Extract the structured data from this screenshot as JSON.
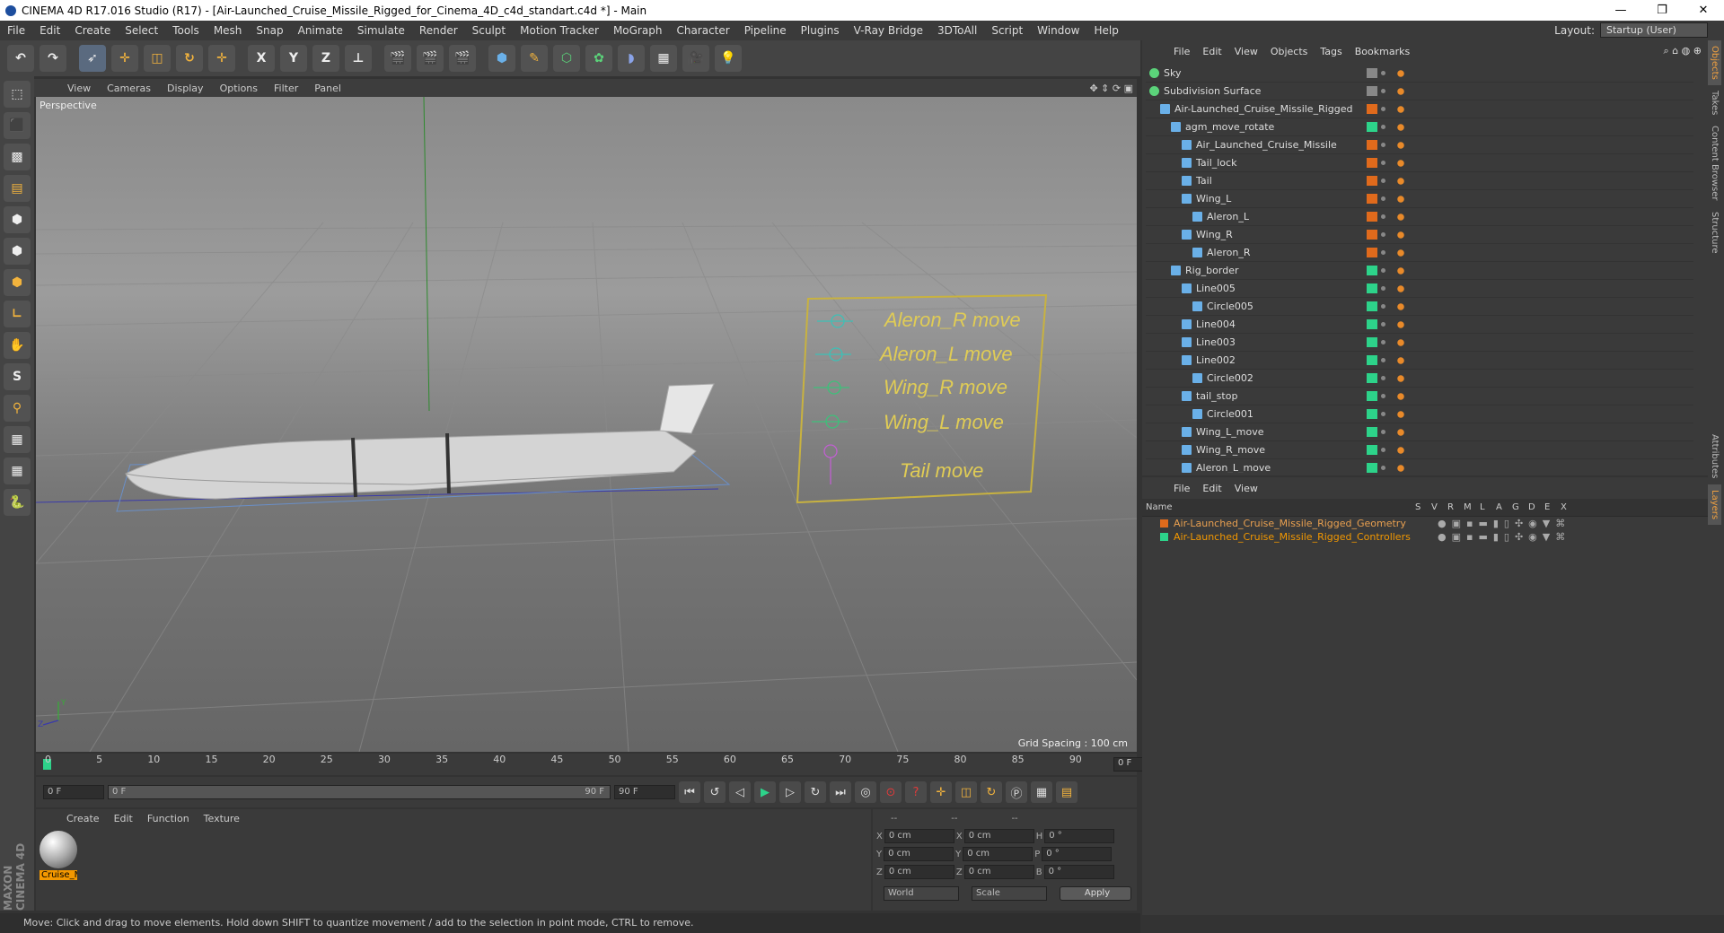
{
  "window": {
    "title": "CINEMA 4D R17.016 Studio (R17) - [Air-Launched_Cruise_Missile_Rigged_for_Cinema_4D_c4d_standart.c4d *] - Main",
    "controls": [
      "—",
      "❐",
      "✕"
    ]
  },
  "menu": [
    "File",
    "Edit",
    "Create",
    "Select",
    "Tools",
    "Mesh",
    "Snap",
    "Animate",
    "Simulate",
    "Render",
    "Sculpt",
    "Motion Tracker",
    "MoGraph",
    "Character",
    "Pipeline",
    "Plugins",
    "V-Ray Bridge",
    "3DToAll",
    "Script",
    "Window",
    "Help"
  ],
  "layout": {
    "label": "Layout:",
    "value": "Startup (User)"
  },
  "toolbar": {
    "x": "X",
    "y": "Y",
    "z": "Z"
  },
  "viewport": {
    "menu": [
      "View",
      "Cameras",
      "Display",
      "Options",
      "Filter",
      "Panel"
    ],
    "label": "Perspective",
    "grid_spacing": "Grid Spacing : 100 cm",
    "controls": [
      "Aleron_R move",
      "Aleron_L move",
      "Wing_R move",
      "Wing_L move",
      "Tail move"
    ],
    "axis_y": "Y",
    "axis_z": "Z"
  },
  "timeline": {
    "ticks": [
      "0",
      "5",
      "10",
      "15",
      "20",
      "25",
      "30",
      "35",
      "40",
      "45",
      "50",
      "55",
      "60",
      "65",
      "70",
      "75",
      "80",
      "85",
      "90"
    ],
    "current": "0 F"
  },
  "playback": {
    "start": "0 F",
    "range_start": "0 F",
    "range_end": "90 F",
    "end": "90 F"
  },
  "material": {
    "menu": [
      "Create",
      "Edit",
      "Function",
      "Texture"
    ],
    "name": "Cruise_M"
  },
  "coords": {
    "header": [
      "--",
      "--",
      "--"
    ],
    "rows": [
      {
        "a": "X",
        "v1": "0 cm",
        "b": "X",
        "v2": "0 cm",
        "c": "H",
        "v3": "0 °"
      },
      {
        "a": "Y",
        "v1": "0 cm",
        "b": "Y",
        "v2": "0 cm",
        "c": "P",
        "v3": "0 °"
      },
      {
        "a": "Z",
        "v1": "0 cm",
        "b": "Z",
        "v2": "0 cm",
        "c": "B",
        "v3": "0 °"
      }
    ],
    "world": "World",
    "scale": "Scale",
    "apply": "Apply"
  },
  "status": "Move: Click and drag to move elements. Hold down SHIFT to quantize movement / add to the selection in point mode, CTRL to remove.",
  "brand": "MAXON CINEMA 4D",
  "objects": {
    "menu": [
      "File",
      "Edit",
      "View",
      "Objects",
      "Tags",
      "Bookmarks"
    ],
    "rows": [
      {
        "name": "Sky",
        "indent": 0,
        "color": "#888888"
      },
      {
        "name": "Subdivision Surface",
        "indent": 0,
        "color": "#888888"
      },
      {
        "name": "Air-Launched_Cruise_Missile_Rigged",
        "indent": 1,
        "color": "#e06a1c"
      },
      {
        "name": "agm_move_rotate",
        "indent": 2,
        "color": "#2dd38a"
      },
      {
        "name": "Air_Launched_Cruise_Missile",
        "indent": 3,
        "color": "#e06a1c"
      },
      {
        "name": "Tail_lock",
        "indent": 3,
        "color": "#e06a1c"
      },
      {
        "name": "Tail",
        "indent": 3,
        "color": "#e06a1c"
      },
      {
        "name": "Wing_L",
        "indent": 3,
        "color": "#e06a1c"
      },
      {
        "name": "Aleron_L",
        "indent": 4,
        "color": "#e06a1c"
      },
      {
        "name": "Wing_R",
        "indent": 3,
        "color": "#e06a1c"
      },
      {
        "name": "Aleron_R",
        "indent": 4,
        "color": "#e06a1c"
      },
      {
        "name": "Rig_border",
        "indent": 2,
        "color": "#2dd38a"
      },
      {
        "name": "Line005",
        "indent": 3,
        "color": "#2dd38a"
      },
      {
        "name": "Circle005",
        "indent": 4,
        "color": "#2dd38a"
      },
      {
        "name": "Line004",
        "indent": 3,
        "color": "#2dd38a"
      },
      {
        "name": "Line003",
        "indent": 3,
        "color": "#2dd38a"
      },
      {
        "name": "Line002",
        "indent": 3,
        "color": "#2dd38a"
      },
      {
        "name": "Circle002",
        "indent": 4,
        "color": "#2dd38a"
      },
      {
        "name": "tail_stop",
        "indent": 3,
        "color": "#2dd38a"
      },
      {
        "name": "Circle001",
        "indent": 4,
        "color": "#2dd38a"
      },
      {
        "name": "Wing_L_move",
        "indent": 3,
        "color": "#2dd38a"
      },
      {
        "name": "Wing_R_move",
        "indent": 3,
        "color": "#2dd38a"
      },
      {
        "name": "Aleron_L_move",
        "indent": 3,
        "color": "#2dd38a"
      }
    ]
  },
  "layers": {
    "menu": [
      "File",
      "Edit",
      "View"
    ],
    "columns": [
      "Name",
      "S",
      "V",
      "R",
      "M",
      "L",
      "A",
      "G",
      "D",
      "E",
      "X"
    ],
    "rows": [
      {
        "name": "Air-Launched_Cruise_Missile_Rigged_Geometry",
        "color": "#e06a1c"
      },
      {
        "name": "Air-Launched_Cruise_Missile_Rigged_Controllers",
        "color": "#2dd38a"
      }
    ]
  },
  "side_tabs": [
    "Objects",
    "Takes",
    "Content Browser",
    "Structure",
    "Attributes",
    "Layers"
  ]
}
